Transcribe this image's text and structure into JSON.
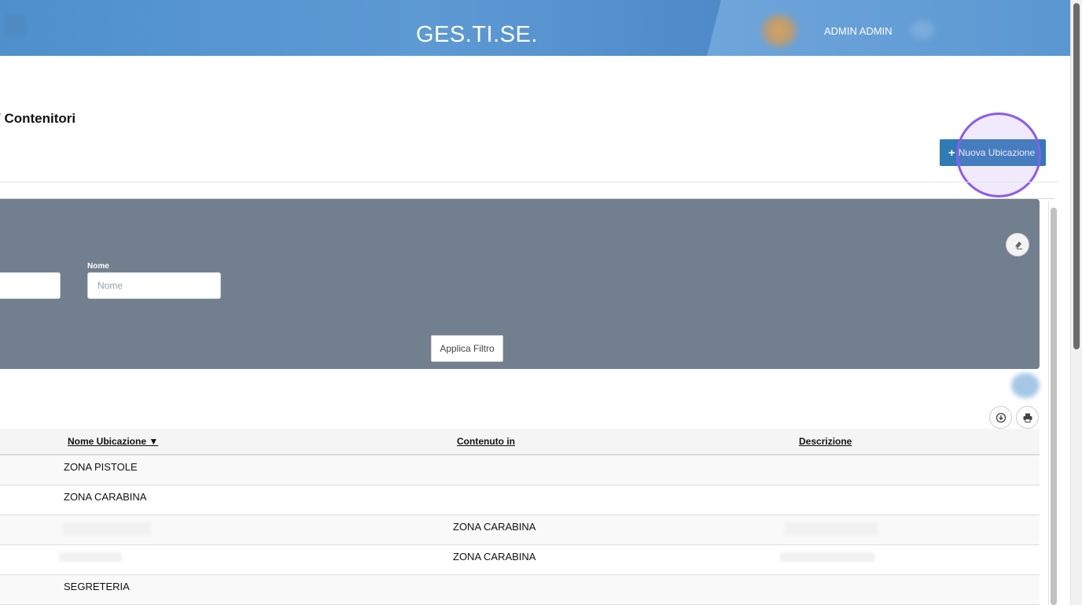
{
  "header": {
    "app_title": "GES.TI.SE.",
    "user_name": "ADMIN ADMIN"
  },
  "page": {
    "title": "/ Contenitori",
    "new_button_label": "Nuova Ubicazione"
  },
  "filter": {
    "name_label": "Nome",
    "name_placeholder": "Nome",
    "name_value": "",
    "apply_label": "Applica Filtro"
  },
  "table": {
    "columns": [
      {
        "label": "Nome Ubicazione ▼",
        "sorted": "desc"
      },
      {
        "label": "Contenuto in"
      },
      {
        "label": "Descrizione"
      }
    ],
    "rows": [
      {
        "name": "ZONA PISTOLE",
        "container": "",
        "description": ""
      },
      {
        "name": "ZONA CARABINA",
        "container": "",
        "description": ""
      },
      {
        "name": "",
        "container": "ZONA CARABINA",
        "description": ""
      },
      {
        "name": "",
        "container": "ZONA CARABINA",
        "description": ""
      },
      {
        "name": "SEGRETERIA",
        "container": "",
        "description": ""
      }
    ]
  },
  "icons": {
    "new": "plus-icon",
    "clear_filter": "eraser-icon",
    "download": "download-icon",
    "print": "print-icon"
  },
  "colors": {
    "header_blue": "#4f90cc",
    "primary_button": "#2f7bb4",
    "filter_panel": "#727f8e",
    "focus_ring": "#8a5cf0"
  }
}
